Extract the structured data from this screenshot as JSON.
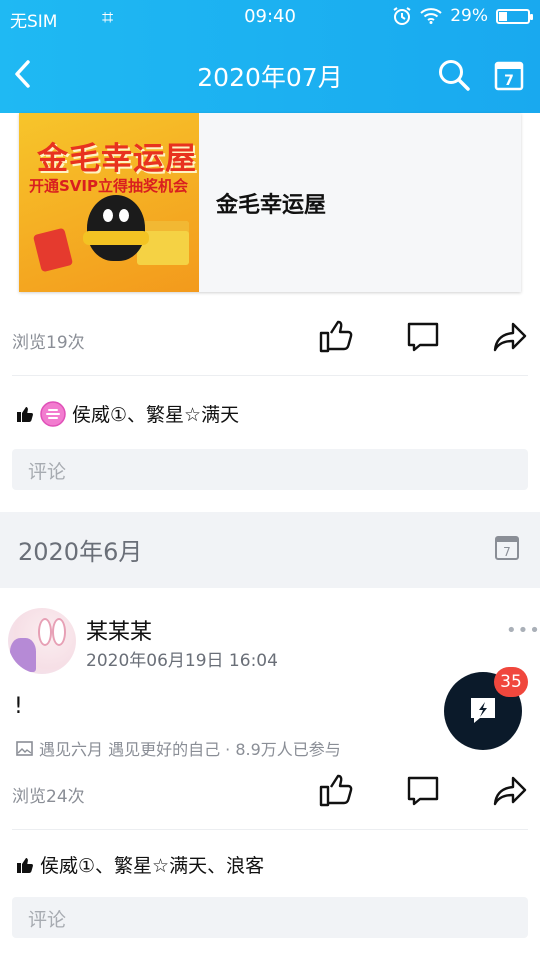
{
  "status_bar": {
    "carrier": "无SIM",
    "time": "09:40",
    "battery": "29%",
    "battery_level": 0.29
  },
  "nav": {
    "title": "2020年07月"
  },
  "post1": {
    "card_title": "金毛幸运屋",
    "banner_title": "金毛幸运屋",
    "banner_subtitle": "开通SVIP立得抽奖机会",
    "views": "浏览19次",
    "likes": "侯威①、繁星☆满天",
    "comment_placeholder": "评论"
  },
  "month_section": {
    "label": "2020年6月"
  },
  "post2": {
    "username": "某某某",
    "date": "2020年06月19日 16:04",
    "text": "!",
    "topic": "遇见六月 遇见更好的自己 · 8.9万人已参与",
    "views": "浏览24次",
    "likes": "侯威①、繁星☆满天、浪客",
    "comment_placeholder": "评论"
  },
  "fab": {
    "badge": "35"
  },
  "colors": {
    "header": "#1aaff0",
    "badge": "#f0473d",
    "fab": "#0b1a2a"
  },
  "icons": [
    "back-icon",
    "search-icon",
    "calendar-icon",
    "thumbs-up-icon",
    "comment-icon",
    "share-icon",
    "image-icon",
    "more-icon",
    "lightning-icon",
    "wifi-icon",
    "alarm-icon",
    "battery-icon"
  ]
}
